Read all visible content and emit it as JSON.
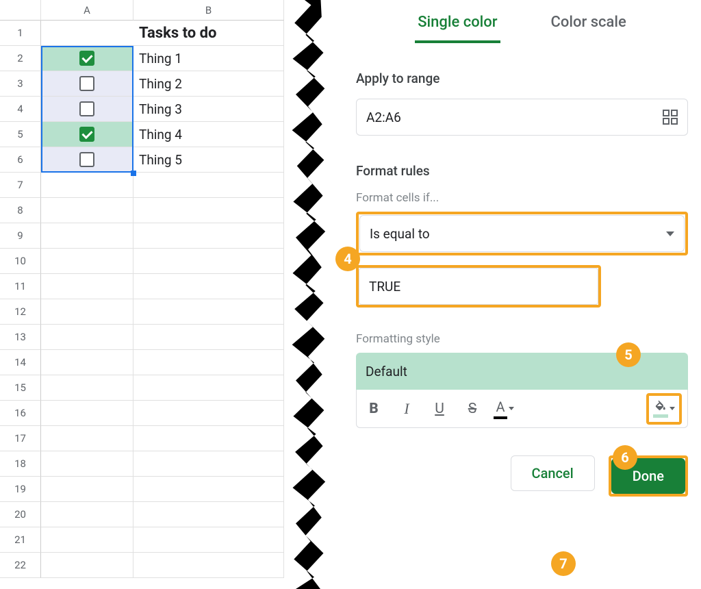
{
  "sheet": {
    "columns": [
      "A",
      "B"
    ],
    "row_numbers": [
      1,
      2,
      3,
      4,
      5,
      6,
      7,
      8,
      9,
      10,
      11,
      12,
      13,
      14,
      15,
      16,
      17,
      18,
      19,
      20,
      21,
      22
    ],
    "title": "Tasks to do",
    "tasks": [
      {
        "checked": true,
        "label": "Thing 1"
      },
      {
        "checked": false,
        "label": "Thing 2"
      },
      {
        "checked": false,
        "label": "Thing 3"
      },
      {
        "checked": true,
        "label": "Thing 4"
      },
      {
        "checked": false,
        "label": "Thing 5"
      }
    ],
    "selection": "A2:A6"
  },
  "panel": {
    "tabs": {
      "single": "Single color",
      "scale": "Color scale",
      "active": "single"
    },
    "apply_label": "Apply to range",
    "apply_value": "A2:A6",
    "rules_label": "Format rules",
    "if_label": "Format cells if...",
    "condition": "Is equal to",
    "condition_value": "TRUE",
    "style_label": "Formatting style",
    "style_preview": "Default",
    "toolbar": {
      "bold": "B",
      "italic": "I",
      "underline": "U",
      "strike": "S",
      "textcolor": "A"
    },
    "buttons": {
      "cancel": "Cancel",
      "done": "Done"
    }
  },
  "callouts": {
    "c4": "4",
    "c5": "5",
    "c6": "6",
    "c7": "7"
  }
}
